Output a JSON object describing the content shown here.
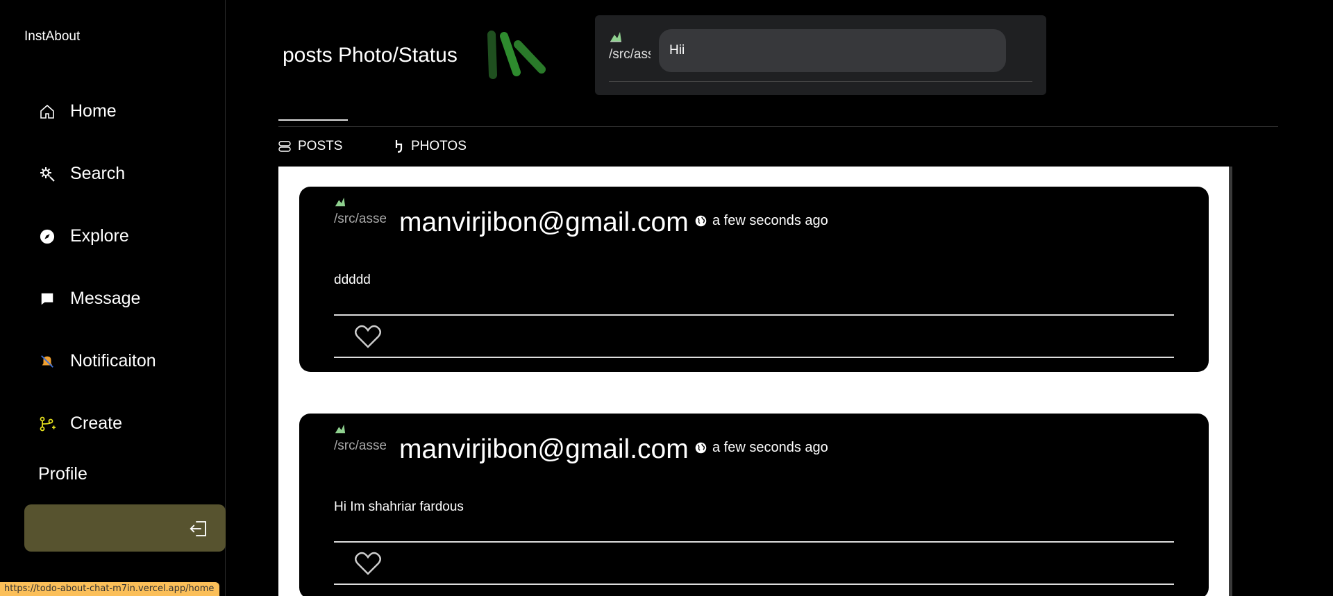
{
  "app": {
    "brand": "InstAbout"
  },
  "sidebar": {
    "items": [
      {
        "label": "Home",
        "icon": "home-icon"
      },
      {
        "label": "Search",
        "icon": "search-settings-icon"
      },
      {
        "label": "Explore",
        "icon": "compass-icon"
      },
      {
        "label": "Message",
        "icon": "message-icon"
      },
      {
        "label": "Notificaiton",
        "icon": "notification-icon"
      },
      {
        "label": "Create",
        "icon": "create-icon"
      }
    ],
    "profile_label": "Profile",
    "logout_icon": "logout-icon"
  },
  "header": {
    "title": "posts Photo/Status"
  },
  "composer": {
    "avatar_alt": "/src/assets",
    "input_value": "Hii"
  },
  "tabs": [
    {
      "label": "POSTS",
      "icon": "posts-icon"
    },
    {
      "label": "PHOTOS",
      "icon": "photos-icon"
    }
  ],
  "posts": [
    {
      "avatar_alt": "/src/assets",
      "author": "manvirjibon@gmail.com",
      "time": "a few seconds ago",
      "body": "ddddd"
    },
    {
      "avatar_alt": "/src/assets",
      "author": "manvirjibon@gmail.com",
      "time": "a few seconds ago",
      "body": "Hi Im shahriar fardous"
    }
  ],
  "status_bar": {
    "url": "https://todo-about-chat-m7in.vercel.app/home"
  },
  "colors": {
    "logout_bg": "#57532f",
    "brand_green": "#2e8b2e",
    "status_url_bg": "#fbbf59"
  }
}
